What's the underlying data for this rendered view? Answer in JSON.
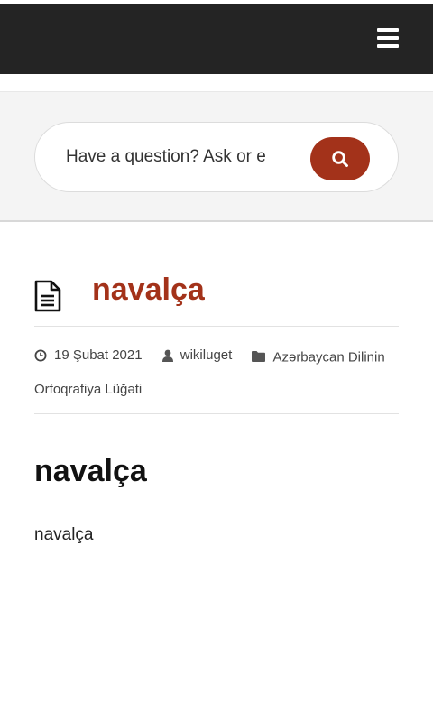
{
  "header": {
    "menu_icon": "hamburger-menu-icon",
    "background_color": "#242424"
  },
  "search": {
    "placeholder": "Have a question? Ask or e",
    "button_icon": "search-icon",
    "button_color": "#a3321a"
  },
  "post": {
    "type_icon": "document-icon",
    "title": "navalça",
    "title_color": "#a3321a",
    "meta": {
      "date_icon": "clock-icon",
      "date": "19 Şubat 2021",
      "author_icon": "user-icon",
      "author": "wikiluget",
      "category_icon": "folder-icon",
      "category": "Azərbaycan Dilinin Orfoqrafiya Lüğəti"
    },
    "content_heading": "navalça",
    "content_text": "navalça"
  }
}
